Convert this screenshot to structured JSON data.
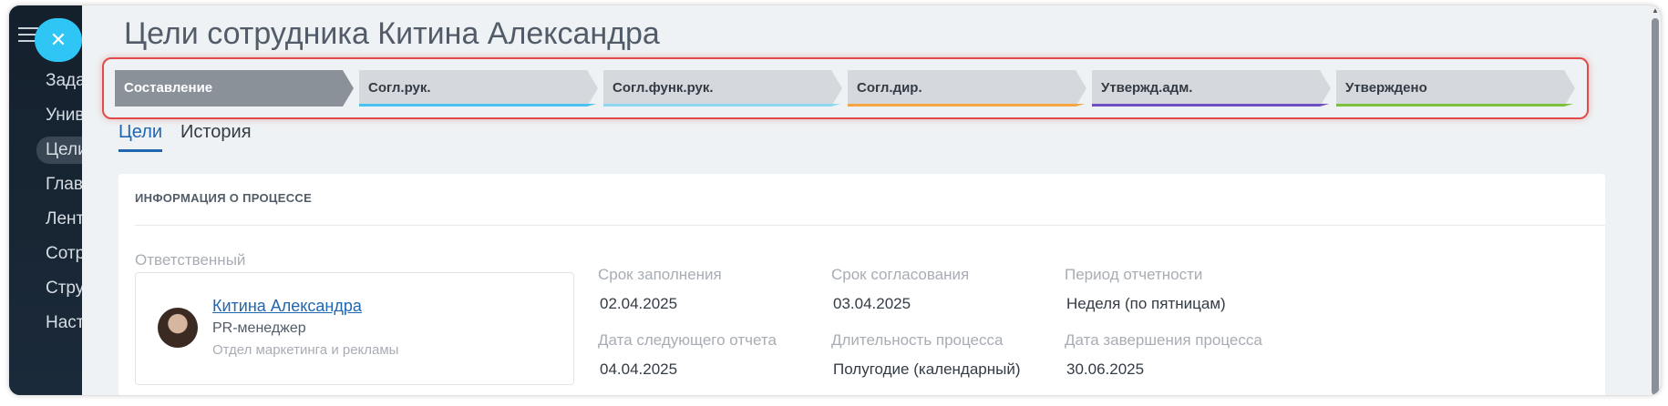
{
  "page": {
    "title": "Цели сотрудника Китина Александра"
  },
  "sidebar": {
    "items": [
      {
        "label": "Задачи"
      },
      {
        "label": "Университет"
      },
      {
        "label": "Цели"
      },
      {
        "label": "Главная"
      },
      {
        "label": "Лента"
      },
      {
        "label": "Сотрудники"
      },
      {
        "label": "Структура"
      },
      {
        "label": "Настройки"
      }
    ]
  },
  "close_button": {
    "glyph": "✕"
  },
  "stages": [
    {
      "label": "Составление",
      "color": "#8a9199",
      "active": true
    },
    {
      "label": "Согл.рук.",
      "color": "#49c2f0",
      "active": false
    },
    {
      "label": "Согл.функ.рук.",
      "color": "#8fd6f0",
      "active": false
    },
    {
      "label": "Согл.дир.",
      "color": "#f5a442",
      "active": false
    },
    {
      "label": "Утвержд.адм.",
      "color": "#6d4fc2",
      "active": false
    },
    {
      "label": "Утверждено",
      "color": "#7cc03d",
      "active": false
    }
  ],
  "tabs": [
    {
      "label": "Цели",
      "active": true
    },
    {
      "label": "История",
      "active": false
    }
  ],
  "info": {
    "heading": "ИНФОРМАЦИЯ О ПРОЦЕССЕ",
    "responsible_label": "Ответственный",
    "employee": {
      "name": "Китина Александра",
      "position": "PR-менеджер",
      "department": "Отдел маркетинга и рекламы"
    },
    "fields": {
      "fill_deadline": {
        "label": "Срок заполнения",
        "value": "02.04.2025"
      },
      "approval_deadline": {
        "label": "Срок согласования",
        "value": "03.04.2025"
      },
      "reporting_period": {
        "label": "Период отчетности",
        "value": "Неделя (по пятницам)"
      },
      "next_report_date": {
        "label": "Дата следующего отчета",
        "value": "04.04.2025"
      },
      "process_duration": {
        "label": "Длительность процесса",
        "value": "Полугодие (календарный)"
      },
      "process_end_date": {
        "label": "Дата завершения процесса",
        "value": "30.06.2025"
      }
    }
  },
  "colors": {
    "accent": "#2067b0",
    "highlight_border": "#e04a4a",
    "close_button": "#2fc6f6"
  }
}
